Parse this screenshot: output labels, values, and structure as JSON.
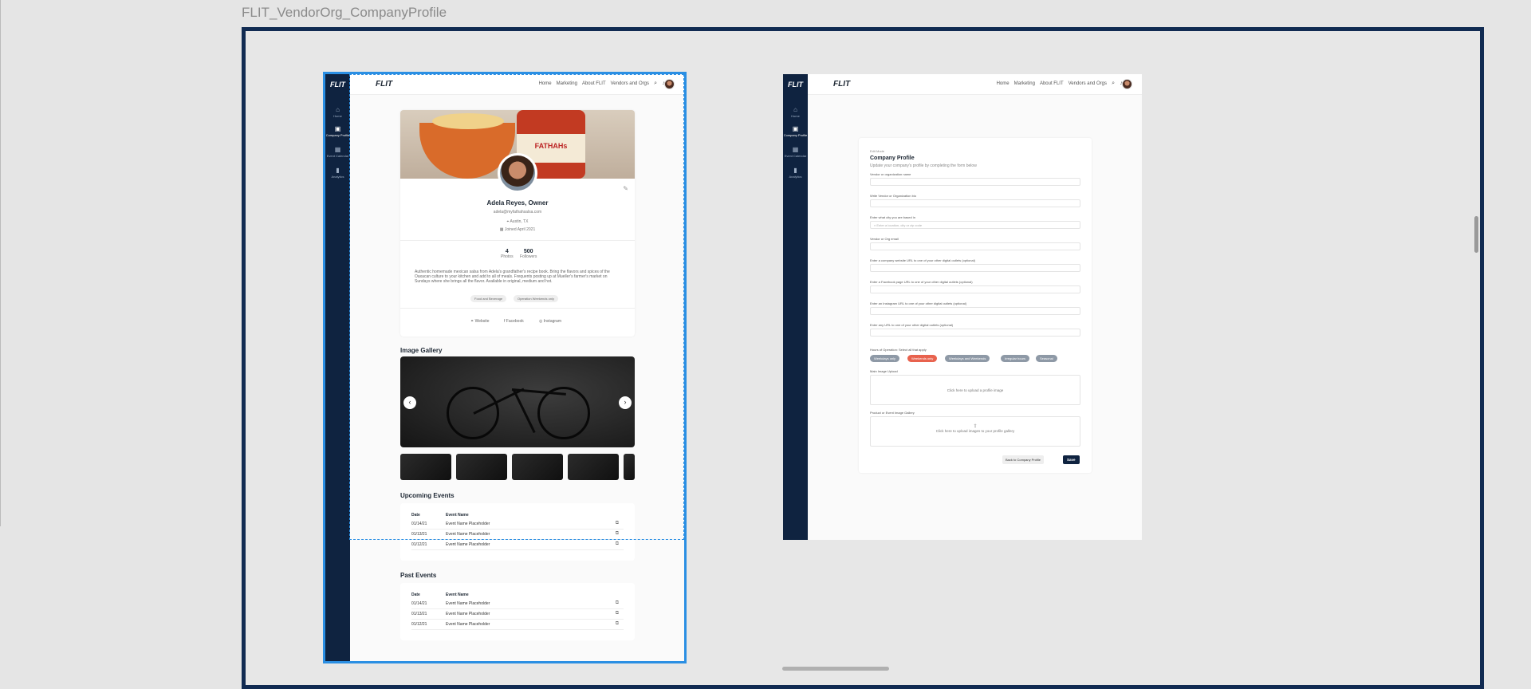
{
  "frame_title": "FLIT_VendorOrg_CompanyProfile",
  "sidebar": {
    "logo": "FLIT",
    "items": [
      {
        "icon": "home-icon",
        "label": "Home"
      },
      {
        "icon": "briefcase-icon",
        "label": "Company Profile"
      },
      {
        "icon": "calendar-icon",
        "label": "Event Calendar"
      },
      {
        "icon": "chart-icon",
        "label": "Analytics"
      }
    ]
  },
  "topbar": {
    "brand": "FLIT",
    "nav": [
      "Home",
      "Marketing",
      "About FLIT",
      "Vendors and Orgs"
    ]
  },
  "profile": {
    "jar_label": "FATHAHs",
    "name": "Adela Reyes, Owner",
    "email": "adela@myfathahsalsa.com",
    "location": "Austin, TX",
    "joined": "Joined April 2021",
    "stats": [
      {
        "value": "4",
        "label": "Photos"
      },
      {
        "value": "500",
        "label": "Followers"
      }
    ],
    "bio": "Authentic homemade mexican salsa from Adela's grandfather's recipe book. Bring the flavors and spices of the Oaxacan culture to your kitchen and add to all of meals. Frequents posting up at Mueller's farmer's market on Sundays where she brings all the flavor. Available in original, medium and hot.",
    "tags": [
      "Food and Beverage",
      "Operation Weekends only"
    ],
    "social": [
      "Website",
      "Facebook",
      "Instagram"
    ]
  },
  "gallery": {
    "title": "Image Gallery"
  },
  "upcoming": {
    "title": "Upcoming Events",
    "head": [
      "Date",
      "Event Name"
    ],
    "rows": [
      {
        "date": "01/14/21",
        "name": "Event Name Placeholder"
      },
      {
        "date": "01/13/21",
        "name": "Event Name Placeholder"
      },
      {
        "date": "01/12/21",
        "name": "Event Name Placeholder"
      }
    ]
  },
  "past": {
    "title": "Past Events",
    "head": [
      "Date",
      "Event Name"
    ],
    "rows": [
      {
        "date": "01/14/21",
        "name": "Event Name Placeholder"
      },
      {
        "date": "01/13/21",
        "name": "Event Name Placeholder"
      },
      {
        "date": "01/12/21",
        "name": "Event Name Placeholder"
      }
    ]
  },
  "form": {
    "mode": "Edit Mode",
    "title": "Company Profile",
    "subtitle": "Update your company's profile by completing the form below",
    "fields": [
      {
        "label": "Vendor or organization name",
        "placeholder": ""
      },
      {
        "label": "Write Vendor or Organization bio",
        "placeholder": ""
      },
      {
        "label": "Enter what city you are based in",
        "placeholder": "Enter a location, city or zip code"
      },
      {
        "label": "Vendor or Org email",
        "placeholder": ""
      },
      {
        "label": "Enter a company website URL to one of your other digital outlets (optional)",
        "placeholder": ""
      },
      {
        "label": "Enter a Facebook page URL to one of your other digital outlets (optional)",
        "placeholder": ""
      },
      {
        "label": "Enter an Instagram URL to one of your other digital outlets (optional)",
        "placeholder": ""
      },
      {
        "label": "Enter any URL to one of your other digital outlets (optional)",
        "placeholder": ""
      }
    ],
    "hours_label": "Hours of Operation: Select all that apply",
    "hours": [
      {
        "label": "Weekdays only",
        "selected": false
      },
      {
        "label": "Weekends only",
        "selected": true
      },
      {
        "label": "Weekdays and Weekends",
        "selected": false
      },
      {
        "label": "Irregular hours",
        "selected": false
      },
      {
        "label": "Seasonal",
        "selected": false
      }
    ],
    "main_upload_label": "Main Image Upload",
    "main_upload_text": "Click here to upload a profile image",
    "gallery_upload_label": "Product or Event Image Gallery",
    "gallery_upload_text": "Click here to upload images to your profile gallery",
    "back_label": "Back to Company Profile",
    "save_label": "Save"
  },
  "colors": {
    "navy": "#0f2340",
    "accent": "#e8624e",
    "selection": "#2b8fe3"
  }
}
